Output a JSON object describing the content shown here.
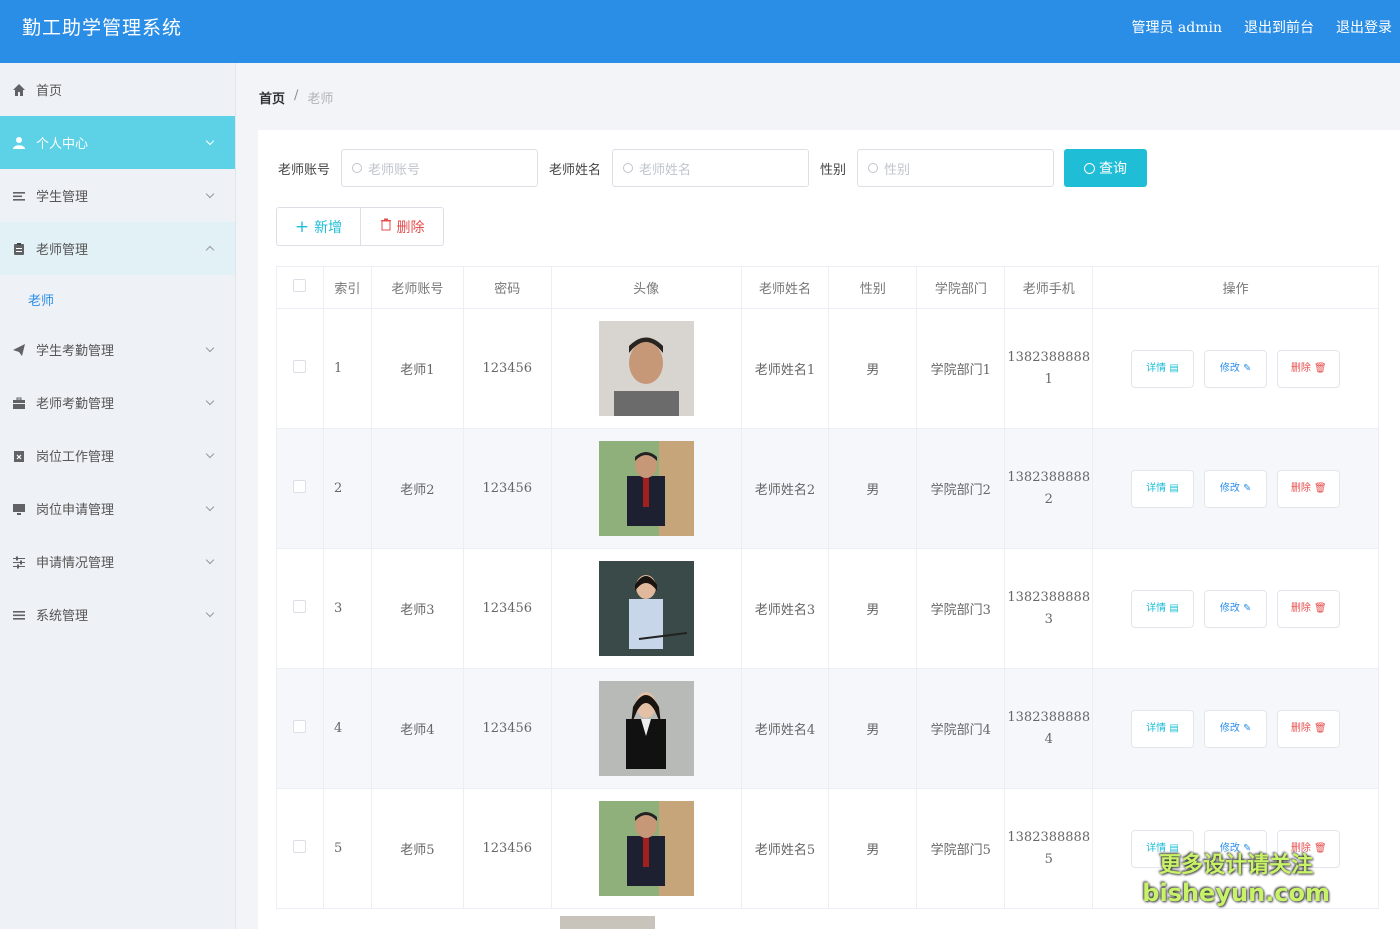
{
  "app": {
    "title": "勤工助学管理系统",
    "admin_label": "管理员 admin",
    "front_link": "退出到前台",
    "logout_link": "退出登录",
    "accent_color": "#2b8ee6",
    "active_color": "#5dd1e6"
  },
  "sidebar": {
    "items": [
      {
        "label": "首页",
        "icon": "home-icon"
      },
      {
        "label": "个人中心",
        "icon": "user-icon"
      },
      {
        "label": "学生管理",
        "icon": "list-icon"
      },
      {
        "label": "老师管理",
        "icon": "clipboard-icon"
      },
      {
        "label": "学生考勤管理",
        "icon": "send-icon"
      },
      {
        "label": "老师考勤管理",
        "icon": "briefcase-icon"
      },
      {
        "label": "岗位工作管理",
        "icon": "calendar-icon"
      },
      {
        "label": "岗位申请管理",
        "icon": "monitor-icon"
      },
      {
        "label": "申请情况管理",
        "icon": "sliders-icon"
      },
      {
        "label": "系统管理",
        "icon": "menu-icon"
      }
    ],
    "sub_item": "老师"
  },
  "breadcrumb": {
    "home": "首页",
    "sep": "/",
    "current": "老师"
  },
  "search": {
    "account_label": "老师账号",
    "account_placeholder": "老师账号",
    "name_label": "老师姓名",
    "name_placeholder": "老师姓名",
    "gender_label": "性别",
    "gender_placeholder": "性别",
    "query_button": "查询"
  },
  "actions": {
    "add": "新增",
    "delete": "删除"
  },
  "table": {
    "headers": [
      "索引",
      "老师账号",
      "密码",
      "头像",
      "老师姓名",
      "性别",
      "学院部门",
      "老师手机",
      "操作"
    ],
    "op_detail": "详情",
    "op_edit": "修改",
    "op_delete": "删除",
    "rows": [
      {
        "index": "1",
        "account": "老师1",
        "password": "123456",
        "name": "老师姓名1",
        "gender": "男",
        "dept": "学院部门1",
        "phone_a": "1382388888",
        "phone_b": "1"
      },
      {
        "index": "2",
        "account": "老师2",
        "password": "123456",
        "name": "老师姓名2",
        "gender": "男",
        "dept": "学院部门2",
        "phone_a": "1382388888",
        "phone_b": "2"
      },
      {
        "index": "3",
        "account": "老师3",
        "password": "123456",
        "name": "老师姓名3",
        "gender": "男",
        "dept": "学院部门3",
        "phone_a": "1382388888",
        "phone_b": "3"
      },
      {
        "index": "4",
        "account": "老师4",
        "password": "123456",
        "name": "老师姓名4",
        "gender": "男",
        "dept": "学院部门4",
        "phone_a": "1382388888",
        "phone_b": "4"
      },
      {
        "index": "5",
        "account": "老师5",
        "password": "123456",
        "name": "老师姓名5",
        "gender": "男",
        "dept": "学院部门5",
        "phone_a": "1382388888",
        "phone_b": "5"
      }
    ]
  },
  "watermark": {
    "line1": "更多设计请关注",
    "line2": "bisheyun.com"
  }
}
